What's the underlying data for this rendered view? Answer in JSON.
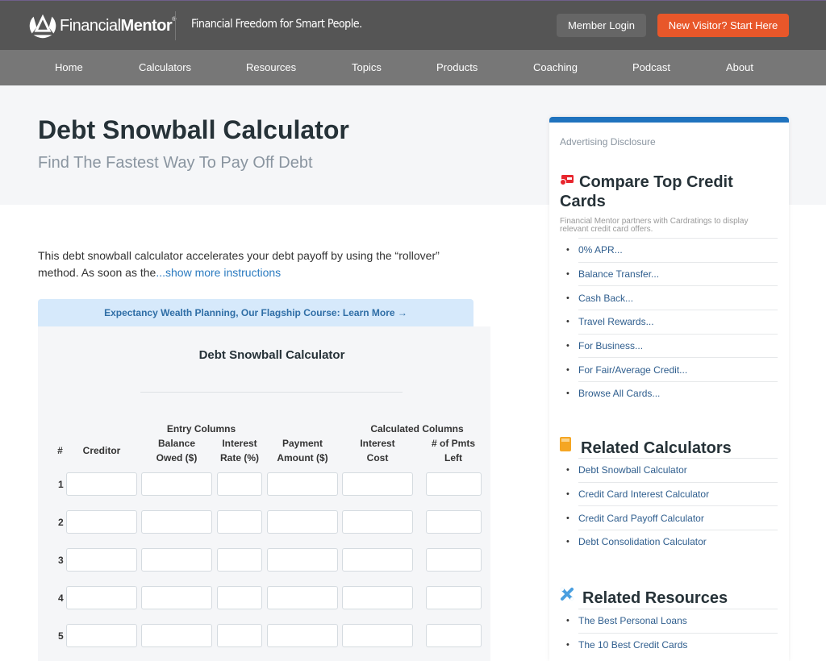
{
  "header": {
    "logo_light": "Financial",
    "logo_bold": "Mentor",
    "logo_mark": "®",
    "tagline": "Financial Freedom for Smart People.",
    "member_login": "Member Login",
    "start_here": "New Visitor? Start Here"
  },
  "nav": [
    "Home",
    "Calculators",
    "Resources",
    "Topics",
    "Products",
    "Coaching",
    "Podcast",
    "About"
  ],
  "page": {
    "title": "Debt Snowball Calculator",
    "subtitle": "Find The Fastest Way To Pay Off Debt",
    "intro": "This debt snowball calculator accelerates your debt payoff by using the “rollover” method. As soon as the",
    "show_more": "...show more instructions",
    "promo": "Expectancy Wealth Planning, Our Flagship Course: Learn More →"
  },
  "calculator": {
    "title": "Debt Snowball Calculator",
    "group_entry": "Entry Columns",
    "group_calculated": "Calculated Columns",
    "columns": {
      "num": "#",
      "creditor": "Creditor",
      "balance_1": "Balance",
      "balance_2": "Owed ($)",
      "rate_1": "Interest",
      "rate_2": "Rate (%)",
      "payment_1": "Payment",
      "payment_2": "Amount ($)",
      "cost_1": "Interest",
      "cost_2": "Cost",
      "pmts_1": "# of Pmts",
      "pmts_2": "Left"
    },
    "rows": [
      {
        "num": "1",
        "creditor": "",
        "balance": "",
        "rate": "",
        "payment": "",
        "interest_cost": "",
        "pmts_left": ""
      },
      {
        "num": "2",
        "creditor": "",
        "balance": "",
        "rate": "",
        "payment": "",
        "interest_cost": "",
        "pmts_left": ""
      },
      {
        "num": "3",
        "creditor": "",
        "balance": "",
        "rate": "",
        "payment": "",
        "interest_cost": "",
        "pmts_left": ""
      },
      {
        "num": "4",
        "creditor": "",
        "balance": "",
        "rate": "",
        "payment": "",
        "interest_cost": "",
        "pmts_left": ""
      },
      {
        "num": "5",
        "creditor": "",
        "balance": "",
        "rate": "",
        "payment": "",
        "interest_cost": "",
        "pmts_left": ""
      }
    ]
  },
  "sidebar": {
    "ad_disclosure": "Advertising Disclosure",
    "compare": {
      "icon": "credit-card-icon",
      "heading": "Compare Top Credit Cards",
      "note": "Financial Mentor partners with Cardratings to display relevant credit card offers.",
      "items": [
        "0% APR...",
        "Balance Transfer...",
        "Cash Back...",
        "Travel Rewards...",
        "For Business...",
        "For Fair/Average Credit...",
        "Browse All Cards..."
      ]
    },
    "calculators": {
      "icon": "calculator-icon",
      "heading": "Related Calculators",
      "items": [
        "Debt Snowball Calculator",
        "Credit Card Interest Calculator",
        "Credit Card Payoff Calculator",
        "Debt Consolidation Calculator"
      ]
    },
    "resources": {
      "icon": "tools-icon",
      "heading": "Related Resources",
      "items": [
        "The Best Personal Loans",
        "The 10 Best Credit Cards"
      ]
    }
  },
  "colors": {
    "topbar": "#555555",
    "nav": "#777777",
    "accent_orange": "#e8572a",
    "link_blue": "#2b7bc0",
    "sidebar_top": "#1f73be",
    "card_icon_red": "#e8262e",
    "calc_icon_orange": "#f5a623",
    "tools_icon_blue": "#4a9fe0"
  }
}
